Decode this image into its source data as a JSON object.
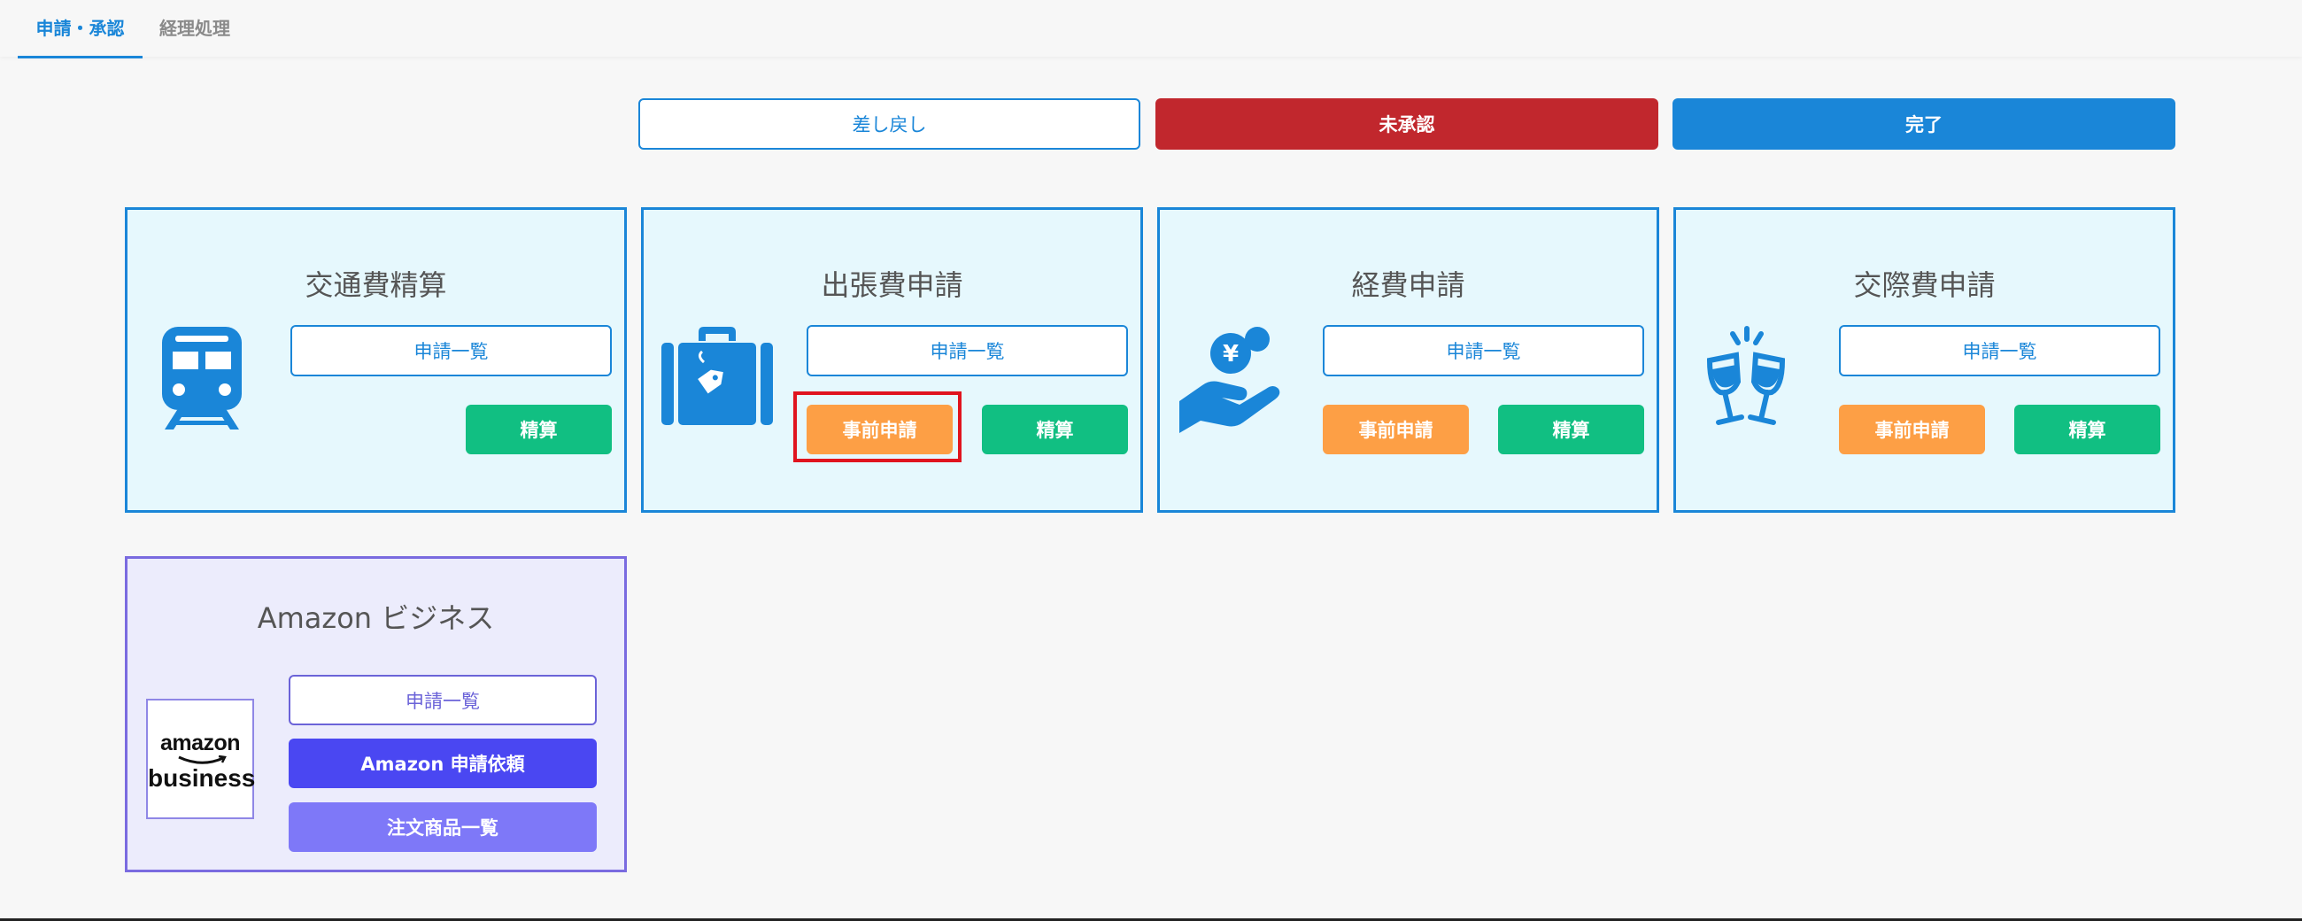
{
  "tabs": [
    {
      "label": "申請・承認",
      "active": true
    },
    {
      "label": "経理処理",
      "active": false
    }
  ],
  "status_buttons": {
    "returned": "差し戻し",
    "unapproved": "未承認",
    "completed": "完了"
  },
  "cards": [
    {
      "title": "交通費精算",
      "icon": "train-icon",
      "list_label": "申請一覧",
      "settle_label": "精算"
    },
    {
      "title": "出張費申請",
      "icon": "suitcase-icon",
      "list_label": "申請一覧",
      "pre_label": "事前申請",
      "settle_label": "精算"
    },
    {
      "title": "経費申請",
      "icon": "yen-hand-icon",
      "list_label": "申請一覧",
      "pre_label": "事前申請",
      "settle_label": "精算"
    },
    {
      "title": "交際費申請",
      "icon": "toast-glasses-icon",
      "list_label": "申請一覧",
      "pre_label": "事前申請",
      "settle_label": "精算"
    }
  ],
  "amazon": {
    "title": "Amazon ビジネス",
    "logo_line1": "amazon",
    "logo_line2": "business",
    "list_label": "申請一覧",
    "request_label": "Amazon 申請依頼",
    "orders_label": "注文商品一覧"
  },
  "colors": {
    "primary": "#1a86d8",
    "danger": "#c1272d",
    "green": "#11bf82",
    "orange": "#fd9f45",
    "amazon_purple": "#4a47f2",
    "highlight": "#e0141e"
  }
}
